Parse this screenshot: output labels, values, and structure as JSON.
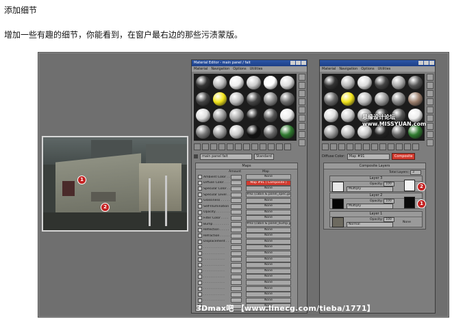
{
  "heading": "添加细节",
  "paragraph": "增加一些有趣的细节，你能看到，在窗户最右边的那些污渍蒙版。",
  "watermark": "思缘设计论坛 www.MISSYUAN.com",
  "caption": "3Dmax吧 【www.linecg.com/tieba/1771】",
  "photo": {
    "marker_1": "1",
    "marker_2": "2"
  },
  "editor_left": {
    "title": "Material Editor - main panel / fait",
    "menu": [
      "Material",
      "Navigation",
      "Options",
      "Utilities"
    ],
    "material_label": "Diffuse Color:",
    "material_name": "main panel  fait",
    "material_type": "Standard",
    "maps_header": "Maps",
    "col_amount": "Amount",
    "col_map": "Map",
    "maps": [
      {
        "label": "Ambient Color . . .",
        "amount": "100",
        "map": "None"
      },
      {
        "label": "Diffuse Color . . .",
        "amount": "100",
        "map": "Map #91  ( Composite )",
        "highlight": true
      },
      {
        "label": "Specular Color . . .",
        "amount": "100",
        "map": "None"
      },
      {
        "label": "Specular Level . . .",
        "amount": "100",
        "map": "#92 (cabin & panel_spec.jpg)"
      },
      {
        "label": "Glossiness . . . . .",
        "amount": "100",
        "map": "None"
      },
      {
        "label": "Self-Illumination",
        "amount": "100",
        "map": "None"
      },
      {
        "label": "Opacity . . . . . . .",
        "amount": "100",
        "map": "None"
      },
      {
        "label": "Filter Color . . . .",
        "amount": "100",
        "map": "None"
      },
      {
        "label": "Bump . . . . . . . .",
        "amount": "30",
        "map": "#93 (cabin & panel_bump.jpg)"
      },
      {
        "label": "Reflection . . . . .",
        "amount": "100",
        "map": "None"
      },
      {
        "label": "Refraction . . . . .",
        "amount": "100",
        "map": "None"
      },
      {
        "label": "Displacement . . .",
        "amount": "100",
        "map": "None"
      },
      {
        "label": ". . . . . . . . . . .",
        "amount": "100",
        "map": "None"
      },
      {
        "label": ". . . . . . . . . . .",
        "amount": "100",
        "map": "None"
      },
      {
        "label": ". . . . . . . . . . .",
        "amount": "100",
        "map": "None"
      },
      {
        "label": ". . . . . . . . . . .",
        "amount": "100",
        "map": "None"
      },
      {
        "label": ". . . . . . . . . . .",
        "amount": "100",
        "map": "None"
      },
      {
        "label": ". . . . . . . . . . .",
        "amount": "100",
        "map": "None"
      },
      {
        "label": ". . . . . . . . . . .",
        "amount": "100",
        "map": "None"
      },
      {
        "label": ". . . . . . . . . . .",
        "amount": "100",
        "map": "None"
      },
      {
        "label": ". . . . . . . . . . .",
        "amount": "100",
        "map": "None"
      },
      {
        "label": ". . . . . . . . . . .",
        "amount": "100",
        "map": "None"
      },
      {
        "label": ". . . . . . . . . . .",
        "amount": "100",
        "map": "None"
      }
    ]
  },
  "editor_right": {
    "material_label": "Diffuse Color:",
    "material_name": "Map #91",
    "material_type": "Composite",
    "composite_header": "Composite Layers",
    "total_layers_label": "Total Layers:",
    "total_layers": "3",
    "layers": [
      {
        "name": "Layer 3",
        "blend": "Multiply",
        "opacity_label": "Opacity:",
        "opacity": "100",
        "marker": "2"
      },
      {
        "name": "Layer 2",
        "blend": "Multiply",
        "opacity_label": "Opacity:",
        "opacity": "100",
        "marker": "1"
      },
      {
        "name": "Layer 1",
        "blend": "Normal",
        "opacity_label": "Opacity:",
        "opacity": "100",
        "mask": "None"
      }
    ]
  }
}
